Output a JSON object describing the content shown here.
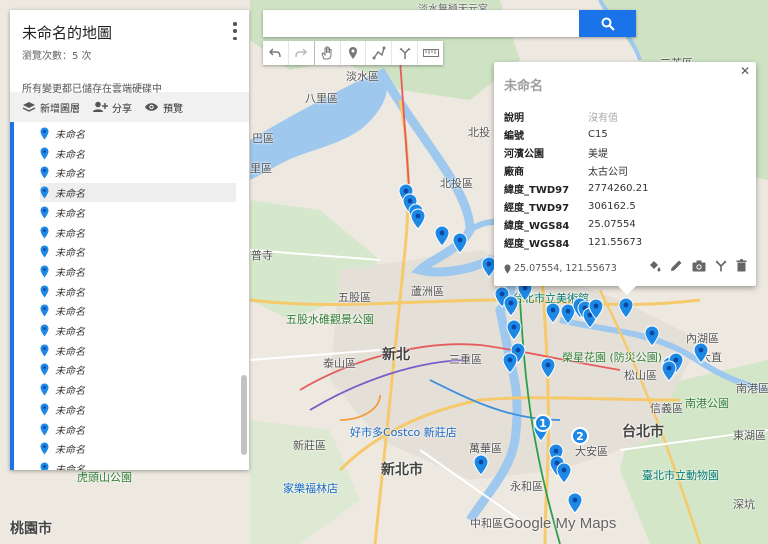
{
  "panel": {
    "title": "未命名的地圖",
    "view_count": "瀏覽次數：5 次",
    "save_status": "所有變更都已儲存在雲端硬碟中",
    "toolbar": {
      "add_layer": "新增圖層",
      "share": "分享",
      "preview": "預覽"
    },
    "items": [
      "未命名",
      "未命名",
      "未命名",
      "未命名",
      "未命名",
      "未命名",
      "未命名",
      "未命名",
      "未命名",
      "未命名",
      "未命名",
      "未命名",
      "未命名",
      "未命名",
      "未命名",
      "未命名",
      "未命名",
      "未命名"
    ],
    "selected_index": 3
  },
  "search": {
    "value": "",
    "placeholder": ""
  },
  "tools": [
    "undo-icon",
    "redo-icon",
    "hand-icon",
    "marker-icon",
    "draw-line-icon",
    "route-icon",
    "ruler-icon"
  ],
  "popup": {
    "title": "未命名",
    "rows": [
      {
        "key": "說明",
        "value": "沒有值",
        "empty": true
      },
      {
        "key": "編號",
        "value": "C15"
      },
      {
        "key": "河濱公園",
        "value": "美堤"
      },
      {
        "key": "廠商",
        "value": "太古公司"
      },
      {
        "key": "緯度_TWD97",
        "value": "2774260.21"
      },
      {
        "key": "經度_TWD97",
        "value": "306162.5"
      },
      {
        "key": "緯度_WGS84",
        "value": "25.07554"
      },
      {
        "key": "經度_WGS84",
        "value": "121.55673"
      }
    ],
    "coordinates": "25.07554, 121.55673",
    "actions": [
      "paint-bucket-icon",
      "edit-icon",
      "camera-icon",
      "route-icon",
      "delete-icon"
    ]
  },
  "map": {
    "labels": [
      "淡水區",
      "淡水無極天元宮",
      "三芝區",
      "北投區",
      "八里區",
      "五股區",
      "蘆洲區",
      "五股水碓觀景公園",
      "新北",
      "泰山區",
      "三重區",
      "新莊區",
      "好市多Costco 新莊店",
      "家樂福林店",
      "新北市",
      "萬華區",
      "永和區",
      "中和區",
      "桃園市",
      "虎頭山公園",
      "內湖區",
      "大直",
      "松山區",
      "信義區",
      "台北市",
      "南港區",
      "南港公園",
      "大安區",
      "東湖區",
      "深坑",
      "臺北市立動物園",
      "台北市立美術館",
      "榮星花園 (防災公園)",
      "普寺",
      "里區",
      "巴區",
      "北投"
    ],
    "clusters": [
      "1",
      "2"
    ],
    "brand_colors": {
      "accent": "#1a73e8",
      "marker": "#1e88e5"
    }
  },
  "watermark": {
    "google": "Google",
    "product": "My Maps"
  }
}
